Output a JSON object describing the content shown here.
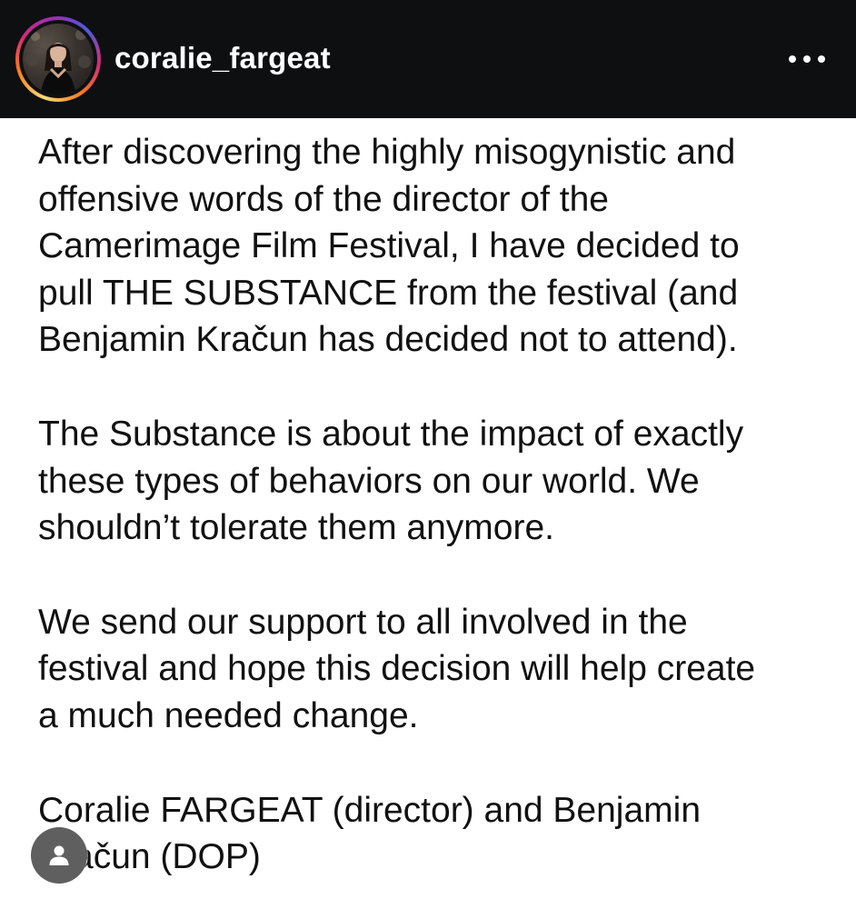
{
  "header": {
    "username": "coralie_fargeat",
    "avatar_icon": "profile-photo",
    "more_icon": "more-horizontal-icon"
  },
  "post": {
    "paragraphs": [
      "After discovering the highly misogynistic and\noffensive words of the director of the\nCamerimage Film Festival, I have decided to\npull THE SUBSTANCE from the festival (and\nBenjamin Kračun has decided not to attend).",
      "The Substance is about the impact of exactly\nthese types of behaviors on our world. We\nshouldn’t tolerate them anymore.",
      "We send our support to all involved in the\nfestival and hope this decision will help create\na much needed change.",
      "Coralie FARGEAT (director) and Benjamin\nKračun (DOP)"
    ]
  },
  "overlay": {
    "user_icon": "user-icon"
  },
  "colors": {
    "header_bg": "#0d0f11",
    "text": "#111111",
    "badge_bg": "#5f5f5f"
  }
}
